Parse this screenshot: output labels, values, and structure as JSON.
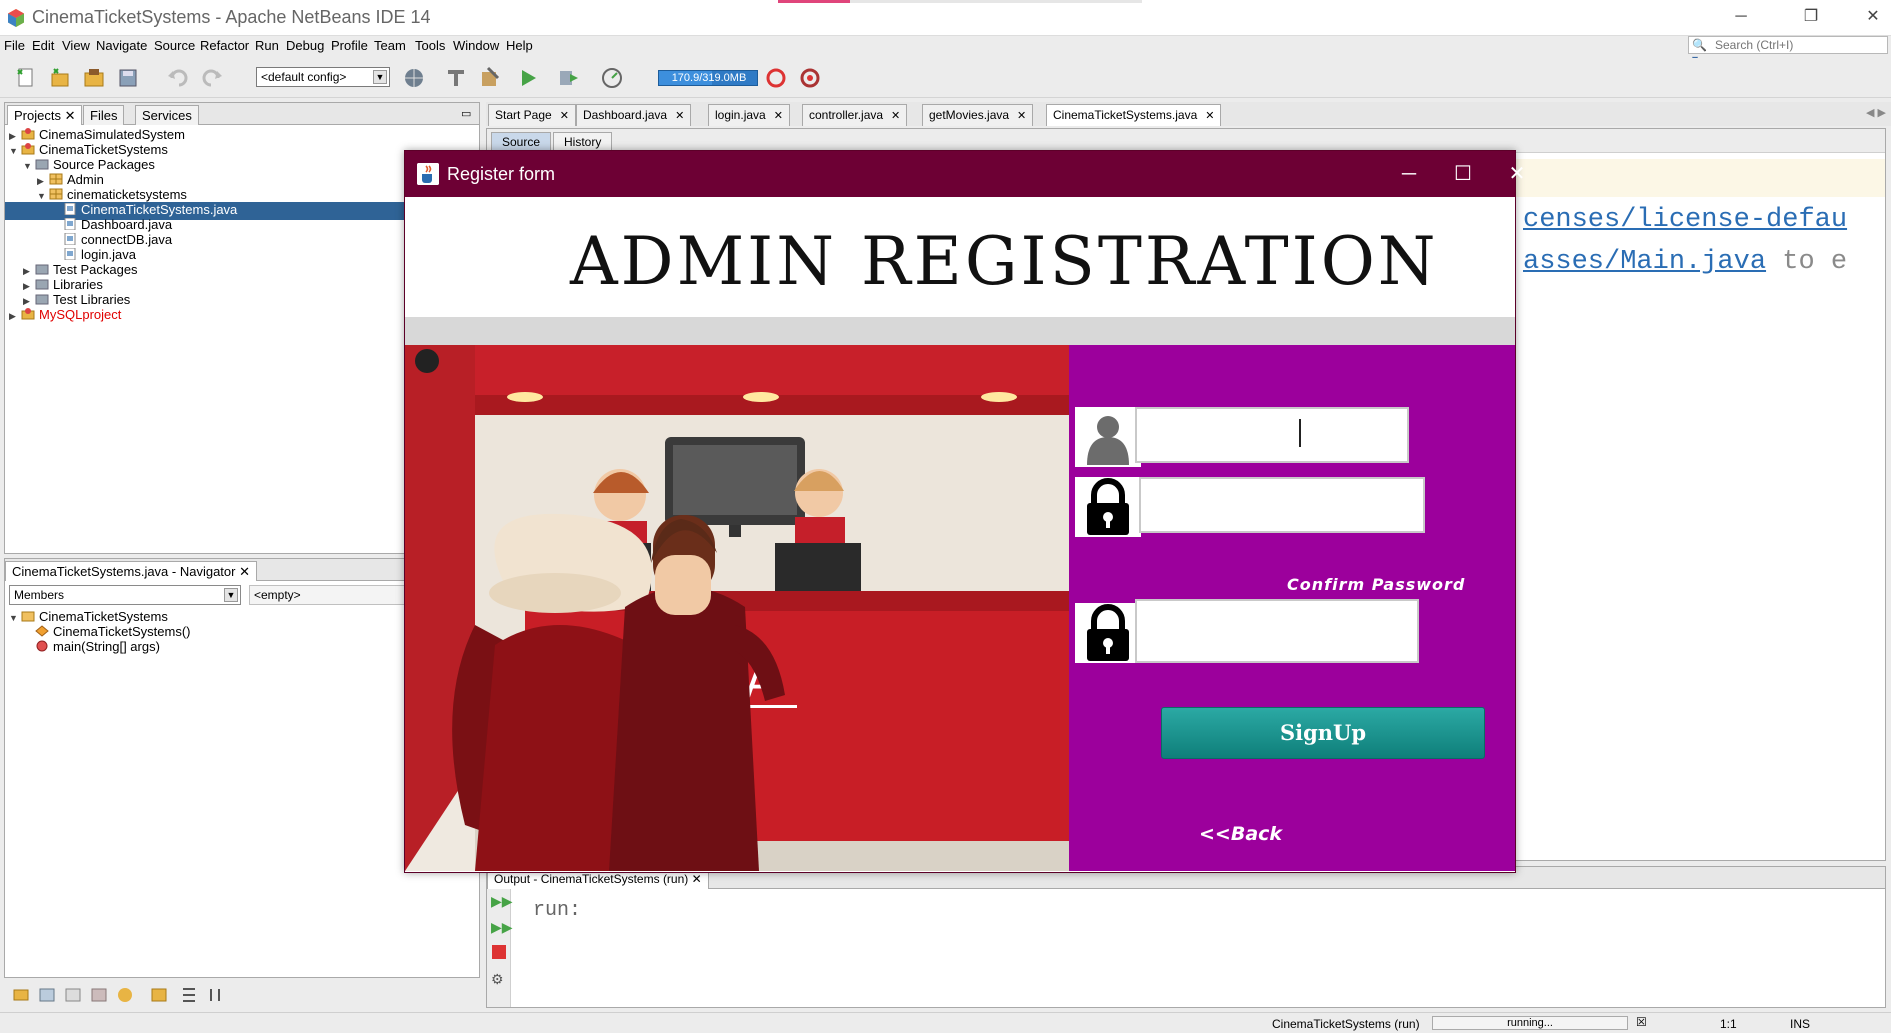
{
  "window": {
    "title": "CinemaTicketSystems - Apache NetBeans IDE 14"
  },
  "menu": [
    "File",
    "Edit",
    "View",
    "Navigate",
    "Source",
    "Refactor",
    "Run",
    "Debug",
    "Profile",
    "Team",
    "Tools",
    "Window",
    "Help"
  ],
  "search": {
    "placeholder": "Search (Ctrl+I)"
  },
  "toolbar": {
    "config": "<default config>",
    "memory": "170.9/319.0MB",
    "memory_fraction": 0.536
  },
  "projects_pane": {
    "tabs": [
      "Projects",
      "Files",
      "Services"
    ],
    "tree": [
      {
        "label": "CinemaSimulatedSystem",
        "depth": 0,
        "toggle": "▶",
        "icon": "project-icon"
      },
      {
        "label": "CinemaTicketSystems",
        "depth": 0,
        "toggle": "▼",
        "icon": "project-icon"
      },
      {
        "label": "Source Packages",
        "depth": 1,
        "toggle": "▼",
        "icon": "folder-icon"
      },
      {
        "label": "Admin",
        "depth": 2,
        "toggle": "▶",
        "icon": "package-icon"
      },
      {
        "label": "cinematicketsystems",
        "depth": 2,
        "toggle": "▼",
        "icon": "package-icon"
      },
      {
        "label": "CinemaTicketSystems.java",
        "depth": 3,
        "toggle": "",
        "icon": "java-file-icon",
        "selected": true
      },
      {
        "label": "Dashboard.java",
        "depth": 3,
        "toggle": "",
        "icon": "java-file-icon"
      },
      {
        "label": "connectDB.java",
        "depth": 3,
        "toggle": "",
        "icon": "java-file-icon"
      },
      {
        "label": "login.java",
        "depth": 3,
        "toggle": "",
        "icon": "java-file-icon"
      },
      {
        "label": "Test Packages",
        "depth": 1,
        "toggle": "▶",
        "icon": "folder-icon"
      },
      {
        "label": "Libraries",
        "depth": 1,
        "toggle": "▶",
        "icon": "folder-icon"
      },
      {
        "label": "Test Libraries",
        "depth": 1,
        "toggle": "▶",
        "icon": "folder-icon"
      },
      {
        "label": "MySQLproject",
        "depth": 0,
        "toggle": "▶",
        "icon": "project-icon",
        "error": true
      }
    ]
  },
  "navigator": {
    "title": "CinemaTicketSystems.java - Navigator",
    "members_select": "Members",
    "filter_select": "<empty>",
    "tree": [
      {
        "label": "CinemaTicketSystems",
        "depth": 0,
        "toggle": "▼",
        "icon": "class-icon"
      },
      {
        "label": "CinemaTicketSystems()",
        "depth": 1,
        "toggle": "",
        "icon": "constructor-icon"
      },
      {
        "label": "main(String[] args)",
        "depth": 1,
        "toggle": "",
        "icon": "method-icon"
      }
    ]
  },
  "editor": {
    "tabs": [
      {
        "label": "Start Page"
      },
      {
        "label": "Dashboard.java"
      },
      {
        "label": "login.java"
      },
      {
        "label": "controller.java"
      },
      {
        "label": "getMovies.java"
      },
      {
        "label": "CinemaTicketSystems.java",
        "active": true
      }
    ],
    "subtabs": [
      "Source",
      "History"
    ],
    "code_fragment_1": "censes/license-defau",
    "code_fragment_2a": "asses/Main.java",
    "code_fragment_2b": " to e"
  },
  "output": {
    "tab": "Output - CinemaTicketSystems (run)",
    "text": "run:"
  },
  "status": {
    "task": "CinemaTicketSystems (run)",
    "progress": "running...",
    "position": "1:1",
    "mode": "INS"
  },
  "dialog": {
    "title": "Register form",
    "heading": "ADMIN REGISTRATION",
    "confirm_label": "Confirm Password",
    "signup": "SignUp",
    "back": "<<Back",
    "scene_sign": "MA",
    "colors": {
      "titlebar": "#6d0034",
      "form_panel": "#9c009c",
      "button": "#1a948f"
    }
  }
}
